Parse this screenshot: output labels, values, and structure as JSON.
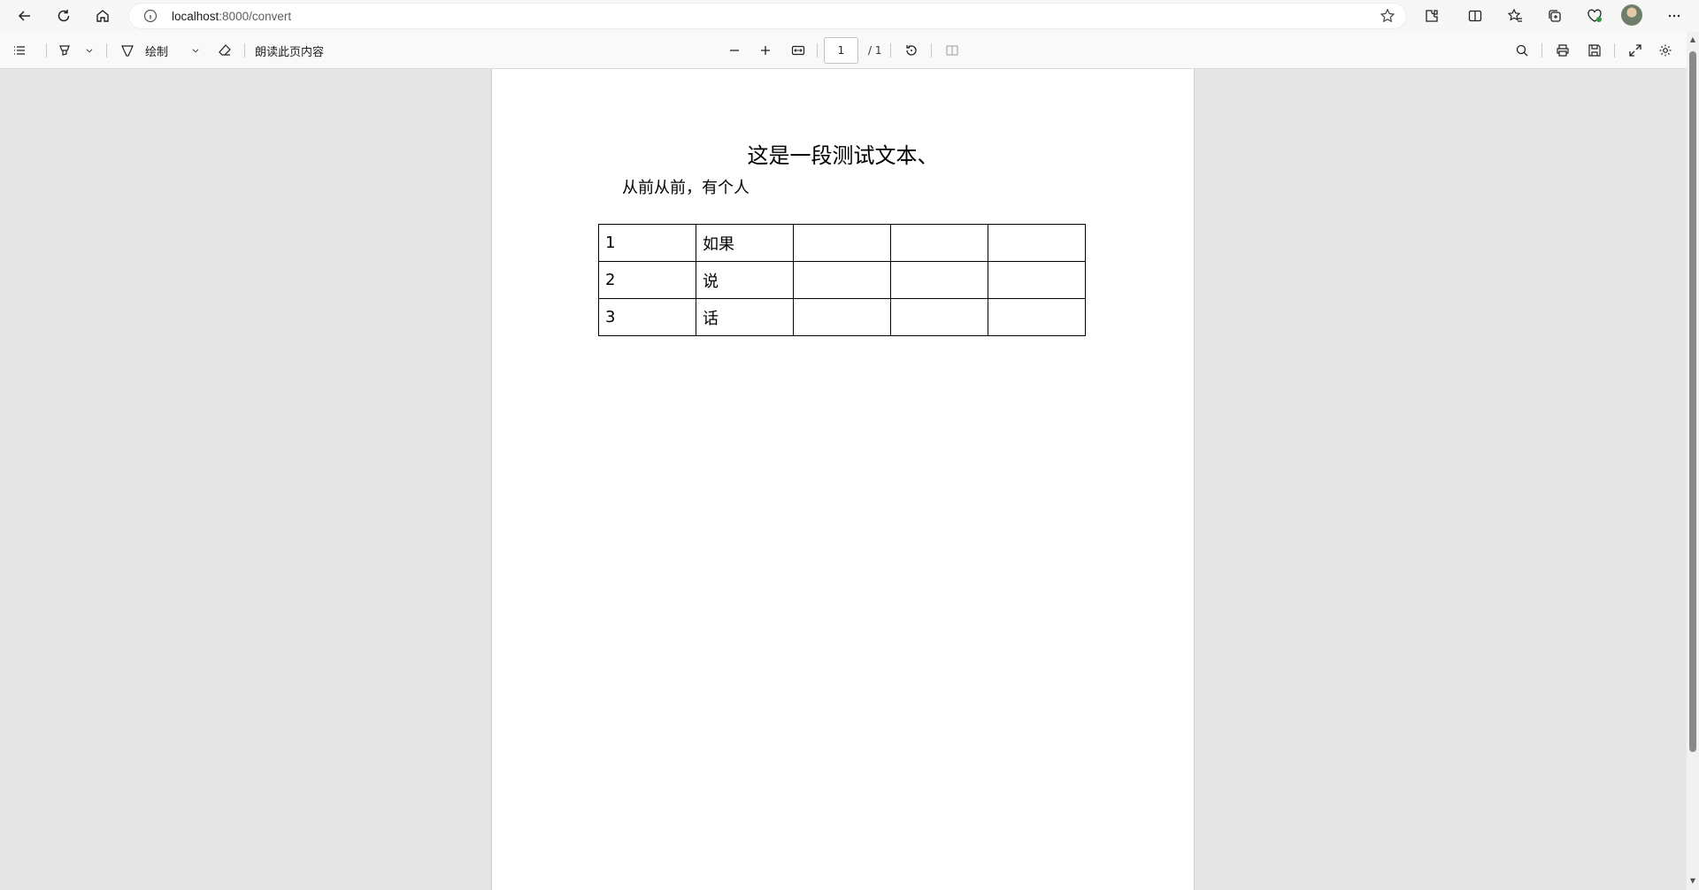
{
  "browser": {
    "url_host": "localhost",
    "url_path": ":8000/convert",
    "icons": [
      "back-icon",
      "refresh-icon",
      "home-icon",
      "info-icon",
      "star-icon",
      "extensions-icon",
      "split-screen-icon",
      "favorites-icon",
      "collections-icon",
      "performance-icon",
      "avatar",
      "more-icon"
    ]
  },
  "pdf_toolbar": {
    "draw_label": "绘制",
    "read_aloud_label": "朗读此页内容",
    "page_current": "1",
    "page_total": "/ 1",
    "icons": [
      "contents-icon",
      "highlight-icon",
      "chevron-down-icon",
      "draw-icon",
      "chevron-down-icon",
      "eraser-icon",
      "zoom-out-icon",
      "zoom-in-icon",
      "fit-page-icon",
      "rotate-icon",
      "page-view-icon",
      "search-icon",
      "print-icon",
      "save-icon",
      "fullscreen-icon",
      "settings-icon"
    ]
  },
  "document": {
    "title": "这是一段测试文本、",
    "paragraph": "从前从前，有个人",
    "table": [
      [
        "1",
        "如果",
        "",
        "",
        ""
      ],
      [
        "2",
        "说",
        "",
        "",
        ""
      ],
      [
        "3",
        "话",
        "",
        "",
        ""
      ]
    ]
  },
  "colors": {
    "chrome_background": "#f7f7f7",
    "viewer_background": "#e6e6e6",
    "page_background": "#ffffff"
  }
}
